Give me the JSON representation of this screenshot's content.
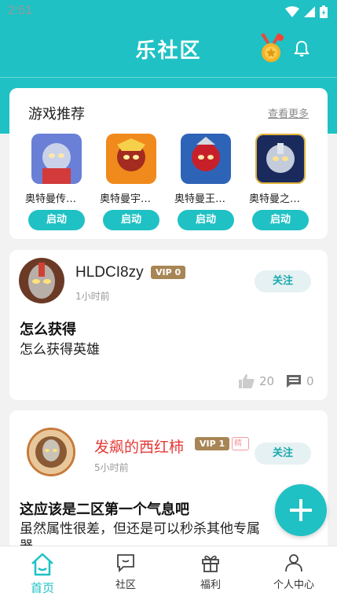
{
  "status": {
    "time": "2:51"
  },
  "header": {
    "title": "乐社区",
    "medal_icon": "medal-icon",
    "bell_icon": "bell-icon"
  },
  "games_section": {
    "title": "游戏推荐",
    "more": "查看更多",
    "items": [
      {
        "name": "奥特曼传…",
        "button": "启动"
      },
      {
        "name": "奥特曼宇…",
        "button": "启动"
      },
      {
        "name": "奥特曼王…",
        "button": "启动"
      },
      {
        "name": "奥特曼之…",
        "button": "启动"
      }
    ]
  },
  "posts": [
    {
      "username": "HLDCI8zy",
      "vip": "VIP 0",
      "time": "1小时前",
      "follow": "关注",
      "title": "怎么获得",
      "body": "怎么获得英雄",
      "likes": "20",
      "comments": "0"
    },
    {
      "username": "发飙的西红柿",
      "vip": "VIP 1",
      "extra_tag": "精",
      "time": "5小时前",
      "follow": "关注",
      "title": "这应该是二区第一个气息吧",
      "body": "虽然属性很差，但还是可以秒杀其他专属",
      "body_wrap": "器"
    }
  ],
  "tabs": [
    {
      "label": "首页",
      "icon": "home-icon"
    },
    {
      "label": "社区",
      "icon": "chat-icon"
    },
    {
      "label": "福利",
      "icon": "gift-icon"
    },
    {
      "label": "个人中心",
      "icon": "user-icon"
    }
  ],
  "colors": {
    "accent": "#1fc1c4",
    "vip": "#a88555",
    "username_highlight": "#e53935"
  }
}
